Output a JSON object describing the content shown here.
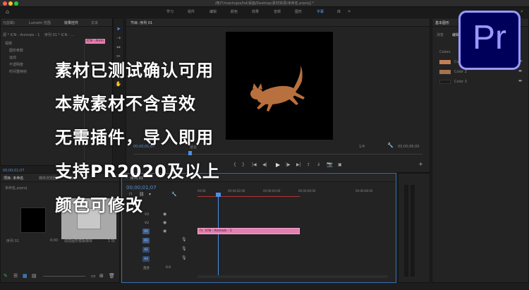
{
  "window": {
    "title": "/用户/macingos/hd/桌面/Desktop/素材资源/未命名.prproj] *"
  },
  "menu": {
    "items": [
      "学习",
      "组件",
      "编辑",
      "颜色",
      "效果",
      "音频",
      "图形",
      "字幕",
      "库"
    ],
    "active": "字幕"
  },
  "left_panel": {
    "tabs": [
      "元剪辑)",
      "Lumetri 范围",
      "效果控件",
      "文本"
    ],
    "active_tab": "效果控件",
    "source_label": "源 * ICN - Animals - 1",
    "sequence_label": "序列 01 * ICN - ...",
    "clip_chip": "ICN - Anim",
    "section": "视频",
    "effects": [
      "图形参数",
      "运动",
      "不透明度",
      "时间重映射"
    ],
    "timecode": "00;00;01;07"
  },
  "program": {
    "title": "节目: 序列 01",
    "timecode_left": "00;00;01;07",
    "fit_label": "适合",
    "zoom_label": "1/4",
    "timecode_right": "00;00;06;00"
  },
  "project": {
    "tabs": [
      "项目: 未命名",
      "媒体浏览器",
      "库"
    ],
    "file_label": "未命名.prproj",
    "items": [
      {
        "name": "序列 01",
        "duration": "6;00"
      },
      {
        "name": "动态图形模板媒体",
        "duration": "1 项"
      }
    ]
  },
  "timeline": {
    "title": "序列 01",
    "timecode": "00;00;01;07",
    "ruler": [
      "00;00",
      "00;00;02;00",
      "00;00;04;00",
      "00;00;06;00",
      "00;00;08;00"
    ],
    "tracks_video": [
      "V3",
      "V2",
      "V1"
    ],
    "tracks_audio": [
      "A1",
      "A2",
      "A3"
    ],
    "master_label": "混合",
    "master_value": "0.0",
    "clip_label": "ICN - Animals - 1"
  },
  "essential_graphics": {
    "title": "基本图形",
    "tabs": [
      "浏览",
      "编辑"
    ],
    "group_label": "Colors",
    "colors": [
      {
        "label": "Color 1",
        "hex": "#c47f55"
      },
      {
        "label": "Color 2",
        "hex": "#a9714f"
      },
      {
        "label": "Color 3",
        "hex": "#1a1a1a"
      }
    ]
  },
  "promo": {
    "lines": [
      "素材已测试确认可用",
      "本款素材不含音效",
      "无需插件，导入即用",
      "支持PR2020及以上",
      "颜色可修改"
    ],
    "logo_text": "Pr"
  }
}
